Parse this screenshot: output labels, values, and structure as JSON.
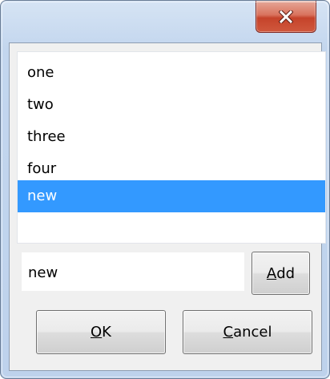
{
  "titlebar": {
    "close_icon": "close-icon"
  },
  "list": {
    "items": [
      "one",
      "two",
      "three",
      "four",
      "new"
    ],
    "selected_index": 4
  },
  "input": {
    "value": "new"
  },
  "buttons": {
    "add": {
      "mnemonic": "A",
      "rest": "dd"
    },
    "ok": {
      "mnemonic": "O",
      "rest": "K"
    },
    "cancel": {
      "mnemonic": "C",
      "rest": "ancel"
    }
  },
  "colors": {
    "selection": "#3399ff",
    "close_button": "#c5432b",
    "frame": "#c3d6ee"
  }
}
